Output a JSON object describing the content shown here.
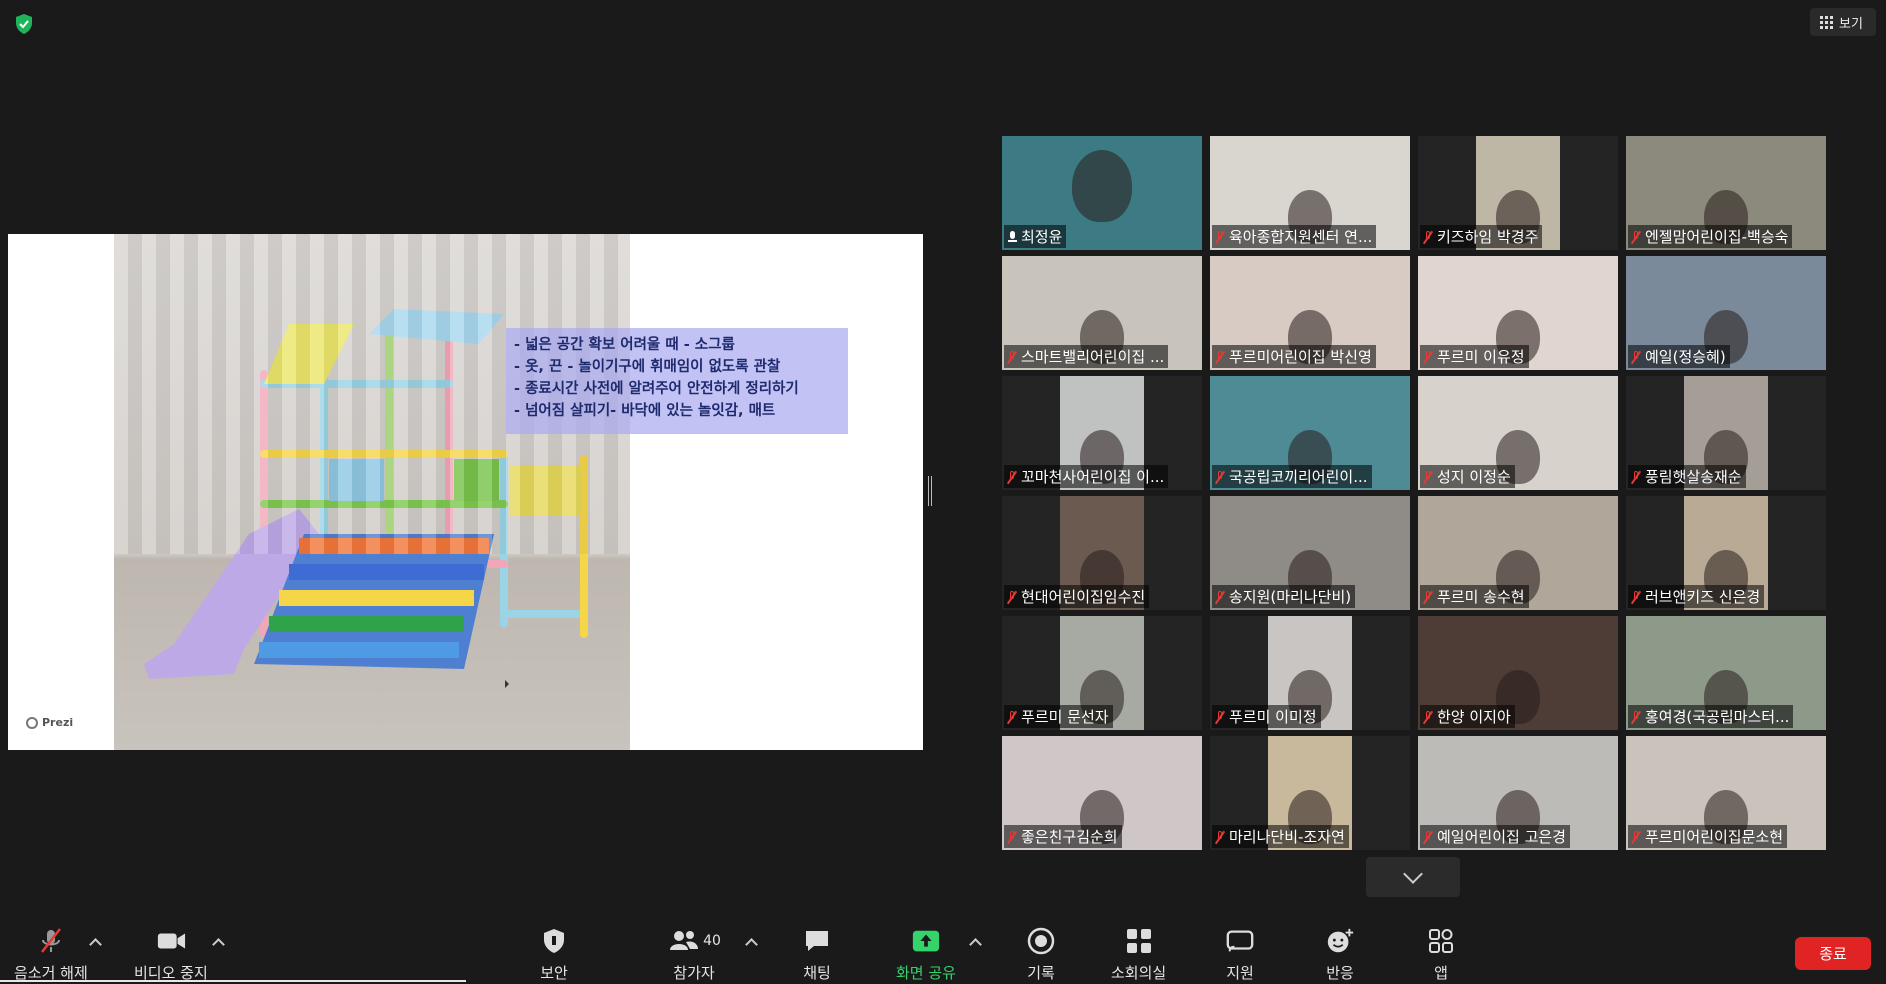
{
  "top": {
    "view_label": "보기"
  },
  "slide": {
    "lines": [
      "- 넓은 공간 확보 어려울 때 - 소그룹",
      "- 옷, 끈 - 놀이기구에 휘매임이 없도록 관찰",
      "- 종료시간 사전에 알려주어 안전하게 정리하기",
      "- 넘어짐 살피기- 바닥에 있는 놀잇감, 매트"
    ],
    "brand": "Prezi"
  },
  "participants": [
    {
      "name": "최정윤",
      "muted": false,
      "active": true,
      "bg": "#3c7a84"
    },
    {
      "name": "육아종합지원센터 연...",
      "muted": true,
      "bg": "#d9d6d0"
    },
    {
      "name": "키즈하임 박경주",
      "muted": true,
      "bg": "#bfb7a6",
      "narrow": true
    },
    {
      "name": "엔젤맘어린이집-백승숙",
      "muted": true,
      "bg": "#8c8a7c"
    },
    {
      "name": "스마트밸리어린이집 ...",
      "muted": true,
      "bg": "#c8c4bb"
    },
    {
      "name": "푸르미어린이집 박신영",
      "muted": true,
      "bg": "#d7cbc3"
    },
    {
      "name": "푸르미 이유정",
      "muted": true,
      "bg": "#e0d5cf"
    },
    {
      "name": "예일(정승혜)",
      "muted": true,
      "bg": "#7a8a9a"
    },
    {
      "name": "꼬마천사어린이집 이...",
      "muted": true,
      "bg": "#bfc2c0",
      "narrow": true
    },
    {
      "name": "국공립코끼리어린이...",
      "muted": true,
      "bg": "#4e8b95"
    },
    {
      "name": "성지 이정순",
      "muted": true,
      "bg": "#d8d2cc"
    },
    {
      "name": "풍림햇살송재순",
      "muted": true,
      "bg": "#a59e97",
      "narrow": true
    },
    {
      "name": "현대어린이집임수진",
      "muted": true,
      "bg": "#6b5a4f",
      "narrow": true
    },
    {
      "name": "송지원(마리나단비)",
      "muted": true,
      "bg": "#8f8b86"
    },
    {
      "name": "푸르미 송수현",
      "muted": true,
      "bg": "#b1a69a"
    },
    {
      "name": "러브앤키즈 신은경",
      "muted": true,
      "bg": "#b8aa94",
      "narrow": true
    },
    {
      "name": "푸르미 문선자",
      "muted": true,
      "bg": "#a7aaa3",
      "narrow": true
    },
    {
      "name": "푸르미 이미정",
      "muted": true,
      "bg": "#c9c5c2",
      "narrow": true
    },
    {
      "name": "한양 이지아",
      "muted": true,
      "bg": "#4d3d36"
    },
    {
      "name": "홍여경(국공립마스터...",
      "muted": true,
      "bg": "#8d9a8a"
    },
    {
      "name": "좋은친구김순희",
      "muted": true,
      "bg": "#cfc6c8"
    },
    {
      "name": "마리나단비-조자연",
      "muted": true,
      "bg": "#c8b99c",
      "narrow": true
    },
    {
      "name": "예일어린이집 고은경",
      "muted": true,
      "bg": "#bdbbb7"
    },
    {
      "name": "푸르미어린이집문소현",
      "muted": true,
      "bg": "#c9c3bc"
    }
  ],
  "toolbar": {
    "unmute": "음소거 해제",
    "stop_video": "비디오 중지",
    "security": "보안",
    "participants": "참가자",
    "participant_count": "40",
    "chat": "채팅",
    "share": "화면 공유",
    "record": "기록",
    "breakout": "소회의실",
    "support": "지원",
    "reactions": "반응",
    "apps": "앱",
    "end": "종료"
  },
  "colors": {
    "background": "#1a1a1a",
    "active_speaker": "#d8e83a",
    "share_green": "#34d46a",
    "end_red": "#e02424",
    "shield_green": "#1fb35a"
  }
}
